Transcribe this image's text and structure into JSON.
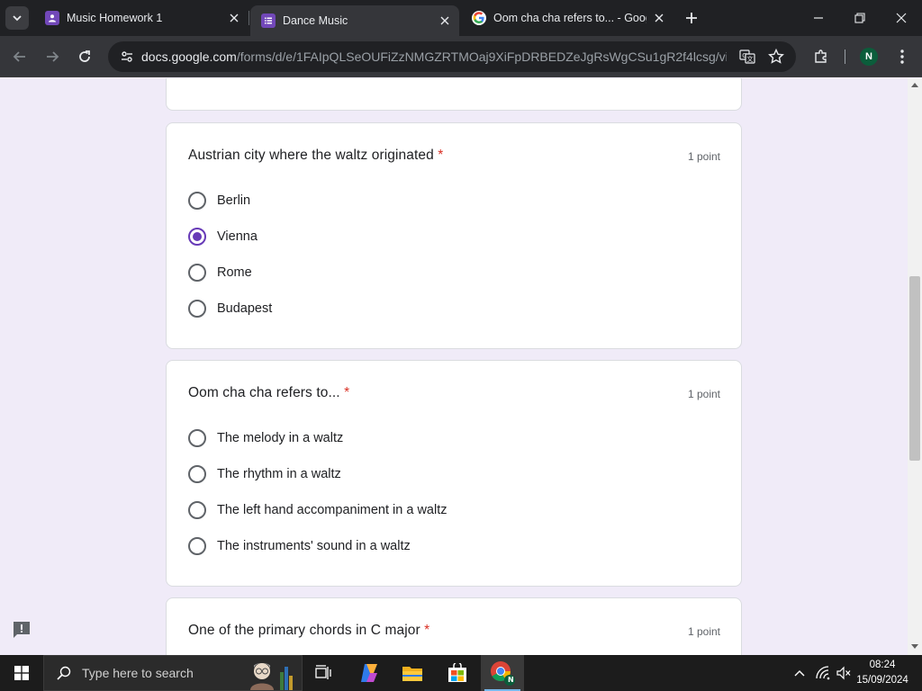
{
  "browser": {
    "tabs": [
      {
        "title": "Music Homework 1",
        "active": false
      },
      {
        "title": "Dance Music",
        "active": true
      },
      {
        "title": "Oom cha cha refers to... - Goog",
        "active": false
      }
    ],
    "url_host": "docs.google.com",
    "url_path": "/forms/d/e/1FAIpQLSeOUFiZzNMGZRTMOaj9XiFpDRBEDZeJgRsWgCSu1gR2f4lcsg/viewf...",
    "profile_initial": "N"
  },
  "form": {
    "required_mark": "*",
    "questions": [
      {
        "title": "Austrian city where the waltz originated",
        "points": "1 point",
        "options": [
          "Berlin",
          "Vienna",
          "Rome",
          "Budapest"
        ],
        "selected": "Vienna"
      },
      {
        "title": "Oom cha cha refers to...",
        "points": "1 point",
        "options": [
          "The melody in a waltz",
          "The rhythm in a waltz",
          "The left hand accompaniment in a waltz",
          "The instruments' sound in a waltz"
        ],
        "selected": null
      },
      {
        "title": "One of the primary chords in C major",
        "points": "1 point",
        "options": [],
        "selected": null
      }
    ]
  },
  "taskbar": {
    "search_placeholder": "Type here to search",
    "time": "08:24",
    "date": "15/09/2024",
    "chrome_badge": "N"
  },
  "colors": {
    "accent": "#673ab7",
    "page_bg": "#f0ebf8",
    "required": "#d93025"
  }
}
